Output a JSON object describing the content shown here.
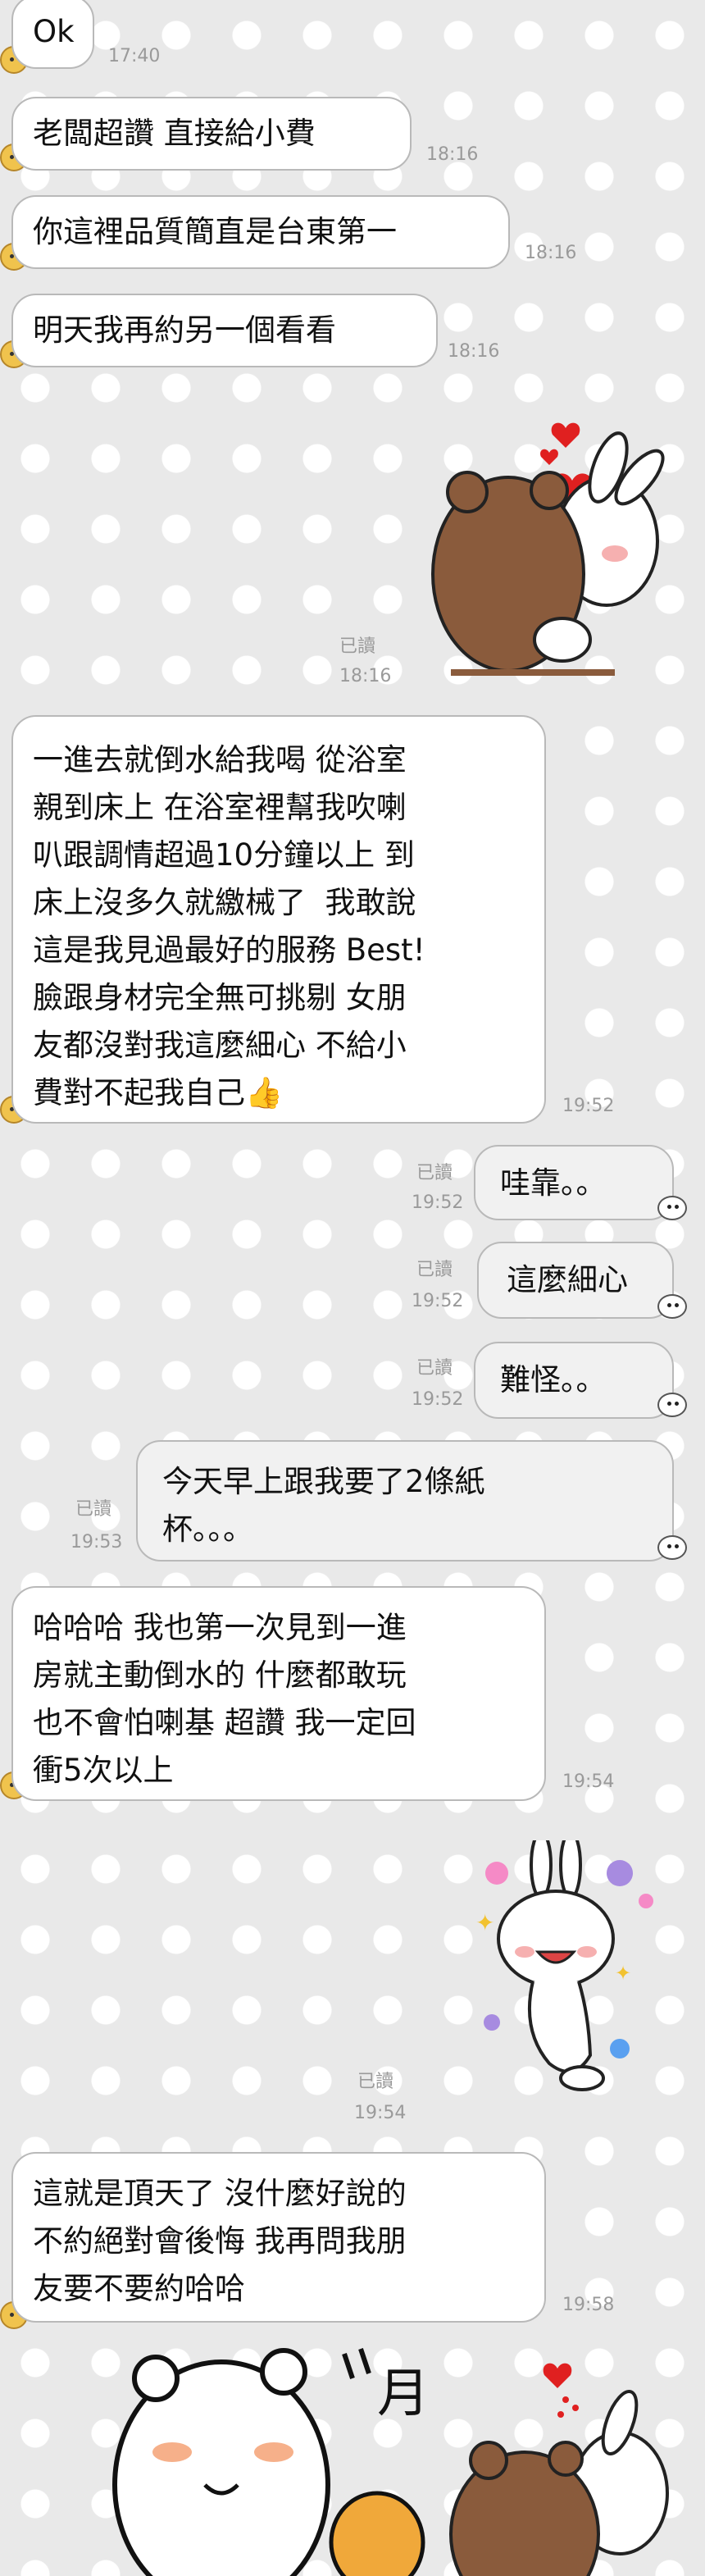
{
  "theme": {
    "bubble_border": "#b9b9b9",
    "time_color": "#9a9a9a",
    "bg": "#e9e9e9"
  },
  "messages": [
    {
      "text": "Ok",
      "time": "17:40"
    },
    {
      "text": "老闆超讚 直接給小費",
      "time": "18:16"
    },
    {
      "text": "你這裡品質簡直是台東第一",
      "time": "18:16"
    },
    {
      "text": "明天我再約另一個看看",
      "time": "18:16"
    },
    {
      "read": "已讀",
      "time": "18:16"
    },
    {
      "text": "一進去就倒水給我喝 從浴室\n親到床上 在浴室裡幫我吹喇\n叭跟調情超過10分鐘以上 到\n床上沒多久就繳械了  我敢說\n這是我見過最好的服務 Best!\n臉跟身材完全無可挑剔 女朋\n友都沒對我這麼細心 不給小\n費對不起我自己👍",
      "time": "19:52"
    },
    {
      "text": "哇靠。。",
      "read": "已讀",
      "time": "19:52"
    },
    {
      "text": "這麼細心",
      "read": "已讀",
      "time": "19:52"
    },
    {
      "text": "難怪。。",
      "read": "已讀",
      "time": "19:52"
    },
    {
      "text": "今天早上跟我要了2條紙\n杯。。。",
      "read": "已讀",
      "time": "19:53"
    },
    {
      "text": "哈哈哈 我也第一次見到一進\n房就主動倒水的 什麼都敢玩\n也不會怕喇基 超讚 我一定回\n衝5次以上",
      "time": "19:54"
    },
    {
      "read": "已讀",
      "time": "19:54"
    },
    {
      "text": "這就是頂天了 沒什麼好說的\n不約絕對會後悔 我再問我朋\n友要不要約哈哈",
      "time": "19:58"
    }
  ],
  "stickers": {
    "bear_hug_1": "bear-hug-sticker",
    "bunny_dance": "bunny-dance-sticker",
    "bear_dance": "white-bear-dance-sticker",
    "bear_hug_2": "bear-hug-sticker",
    "sticker_text": "月",
    "heart_color": "#e02020"
  }
}
